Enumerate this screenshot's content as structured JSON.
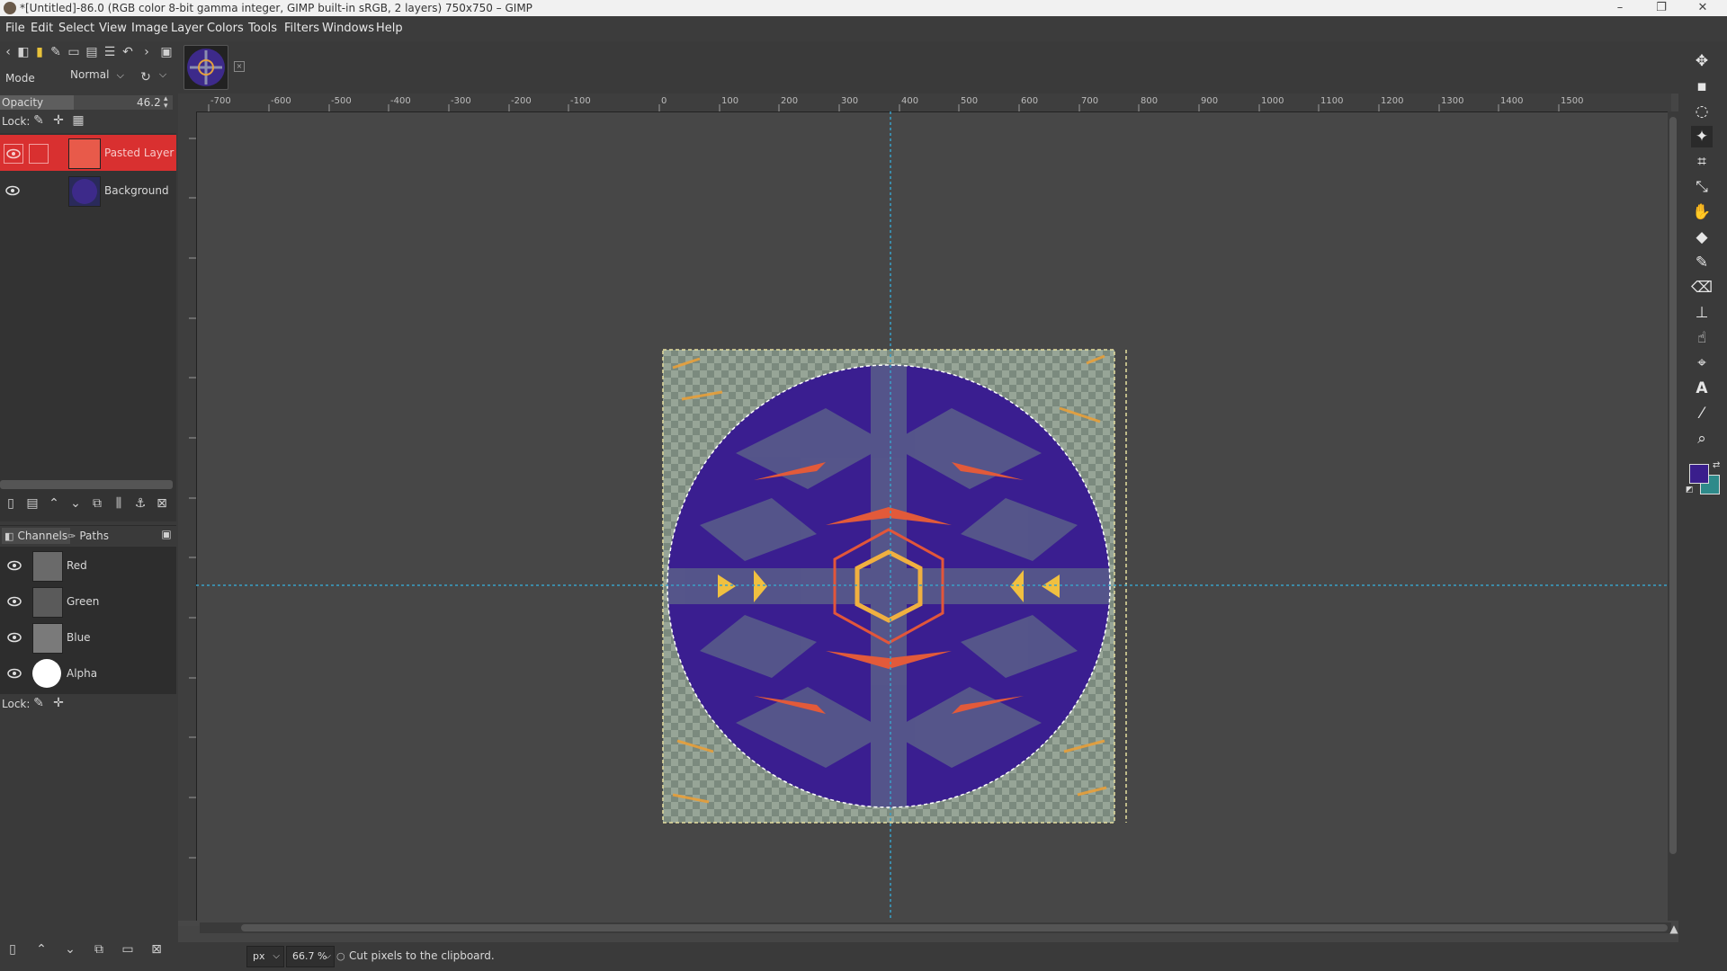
{
  "window": {
    "title": "*[Untitled]-86.0 (RGB color 8-bit gamma integer, GIMP built-in sRGB, 2 layers) 750x750 – GIMP",
    "minimize": "–",
    "maximize": "❐",
    "close": "✕"
  },
  "menubar": [
    "File",
    "Edit",
    "Select",
    "View",
    "Image",
    "Layer",
    "Colors",
    "Tools",
    "Filters",
    "Windows",
    "Help"
  ],
  "layers_panel": {
    "mode_label": "Mode",
    "mode_value": "Normal",
    "opacity_label": "Opacity",
    "opacity_value": "46.2",
    "lock_label": "Lock:",
    "layers": [
      {
        "name": "Pasted Layer",
        "selected": true
      },
      {
        "name": "Background",
        "selected": false
      }
    ]
  },
  "channels_panel": {
    "tab_channels": "Channels",
    "tab_paths": "Paths",
    "channels": [
      "Red",
      "Green",
      "Blue",
      "Alpha"
    ],
    "lock_label": "Lock:"
  },
  "ruler": {
    "labels": [
      "-700",
      "-600",
      "-500",
      "-400",
      "-300",
      "-200",
      "-100",
      "0",
      "100",
      "200",
      "300",
      "400",
      "500",
      "600",
      "700",
      "800",
      "900",
      "1000",
      "1100",
      "1200",
      "1300",
      "1400",
      "1500"
    ]
  },
  "statusbar": {
    "unit": "px",
    "zoom": "66.7 %",
    "message": "Cut pixels to the clipboard."
  },
  "colors": {
    "accent_selected": "#d93030",
    "foreground": "#3a1e8c",
    "background_color": "#2e8a8a",
    "guide": "#39a0c8",
    "selection": "#e7e0a0"
  },
  "icons": {
    "eye": "eye-icon",
    "tools": [
      "move-tool-icon",
      "align-tool-icon",
      "lasso-tool-icon",
      "fuzzy-select-tool-icon",
      "crop-tool-icon",
      "unified-transform-tool-icon",
      "warp-tool-icon",
      "bucket-fill-tool-icon",
      "paintbrush-tool-icon",
      "eraser-tool-icon",
      "clone-tool-icon",
      "smudge-tool-icon",
      "paths-tool-icon",
      "text-tool-icon",
      "color-picker-tool-icon",
      "zoom-tool-icon"
    ]
  }
}
